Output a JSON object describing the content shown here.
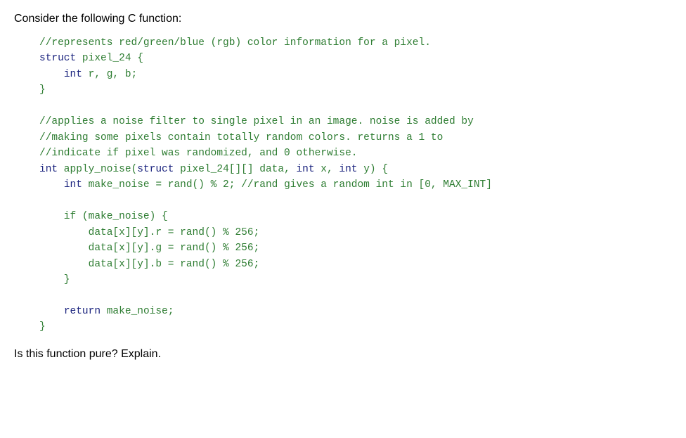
{
  "intro": {
    "text": "Consider the following C function:"
  },
  "code": {
    "comment1": "//represents red/green/blue (rgb) color information for a pixel.",
    "struct_open": "struct pixel_24 {",
    "struct_body": "    int r, g, b;",
    "struct_close": "}",
    "blank1": "",
    "comment2": "//applies a noise filter to single pixel in an image. noise is added by",
    "comment3": "//making some pixels contain totally random colors. returns a 1 to",
    "comment4": "//indicate if pixel was randomized, and 0 otherwise.",
    "func_sig": "int apply_noise(struct pixel_24[][] data, int x, int y) {",
    "make_noise_line": "    int make_noise = rand() % 2; //rand gives a random int in [0, MAX_INT]",
    "blank2": "",
    "if_open": "    if (make_noise) {",
    "assign_r": "        data[x][y].r = rand() % 256;",
    "assign_g": "        data[x][y].g = rand() % 256;",
    "assign_b": "        data[x][y].b = rand() % 256;",
    "if_close": "    }",
    "blank3": "",
    "return_line": "    return make_noise;",
    "func_close": "}"
  },
  "question": {
    "text": "Is this function pure? Explain."
  }
}
